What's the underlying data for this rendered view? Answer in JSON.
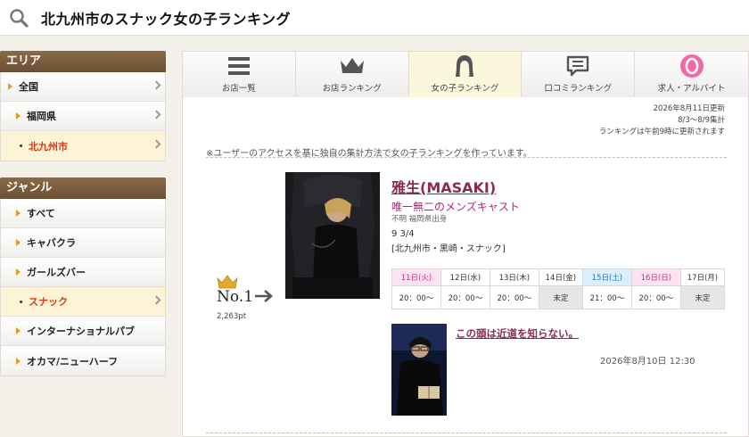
{
  "header": {
    "title": "北九州市のスナック女の子ランキング",
    "search_icon": "search-icon"
  },
  "sidebar": {
    "area_heading": "エリア",
    "area_items": [
      {
        "label": "全国",
        "marker": "triangle",
        "active": false
      },
      {
        "label": "福岡県",
        "marker": "triangle",
        "active": false
      },
      {
        "label": "北九州市",
        "marker": "dot",
        "active": true
      }
    ],
    "genre_heading": "ジャンル",
    "genre_items": [
      {
        "label": "すべて",
        "marker": "triangle",
        "active": false
      },
      {
        "label": "キャバクラ",
        "marker": "triangle",
        "active": false
      },
      {
        "label": "ガールズバー",
        "marker": "triangle",
        "active": false
      },
      {
        "label": "スナック",
        "marker": "dot",
        "active": true
      },
      {
        "label": "インターナショナルパブ",
        "marker": "triangle",
        "active": false
      },
      {
        "label": "オカマ/ニューハーフ",
        "marker": "triangle",
        "active": false
      }
    ]
  },
  "tabs": [
    {
      "label": "お店一覧",
      "icon": "list-icon"
    },
    {
      "label": "お店ランキング",
      "icon": "crown-icon"
    },
    {
      "label": "女の子ランキング",
      "icon": "girl-icon",
      "active": true
    },
    {
      "label": "口コミランキング",
      "icon": "comment-icon"
    },
    {
      "label": "求人・アルバイト",
      "icon": "job-icon"
    }
  ],
  "updated": {
    "date": "2026年8月11日更新",
    "period": "8/3〜8/9集計",
    "note": "ランキングは午前9時に更新されます"
  },
  "note": "※ユーザーのアクセスを基に独自の集計方法で女の子ランキングを作っています。",
  "entry": {
    "rank": "No.1",
    "points": "2,263pt",
    "name": "雅生(MASAKI)",
    "catch": "唯一無二のメンズキャスト",
    "origin": "不明  福岡県出身",
    "size": "9 3/4",
    "shop": "[北九州市・黒崎・スナック]",
    "schedule": [
      {
        "day": "11日(火)",
        "time": "20：00〜",
        "type": "tue"
      },
      {
        "day": "12日(水)",
        "time": "20：00〜",
        "type": ""
      },
      {
        "day": "13日(木)",
        "time": "20：00〜",
        "type": ""
      },
      {
        "day": "14日(金)",
        "time": "未定",
        "type": ""
      },
      {
        "day": "15日(土)",
        "time": "21：00〜",
        "type": "sat"
      },
      {
        "day": "16日(日)",
        "time": "20：00〜",
        "type": "sun"
      },
      {
        "day": "17日(月)",
        "time": "未定",
        "type": ""
      }
    ],
    "blog": {
      "title": "この頭は近道を知らない。",
      "date": "2026年8月10日 12:30"
    }
  },
  "colors": {
    "accent_brown": "#7a5b3d",
    "name": "#8a2d4a",
    "catch": "#b0287a"
  }
}
